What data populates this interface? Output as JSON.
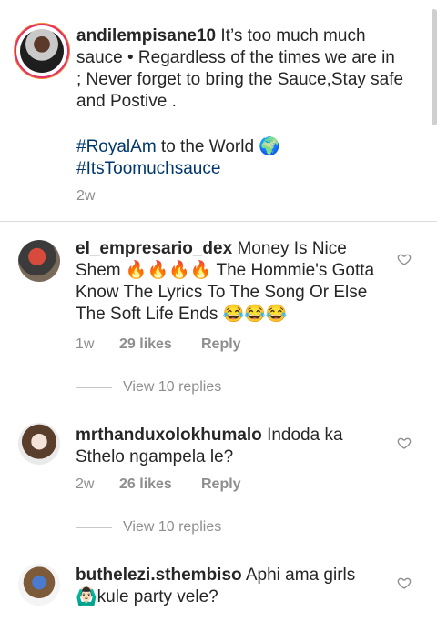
{
  "caption": {
    "username": "andilempisane10",
    "text": " It’s too much much sauce • Regardless of the times we are in ; Never forget to bring the Sauce,Stay safe and Postive .",
    "hashtag1": "#RoyalAm",
    "hashtag1_suffix": " to the World 🌍",
    "hashtag2": "#ItsToomuchsauce",
    "time": "2w"
  },
  "comments": [
    {
      "username": "el_empresario_dex",
      "text": " Money Is Nice Shem 🔥🔥🔥🔥 The Hommie's Gotta Know The Lyrics To The Song Or Else The Soft Life Ends 😂😂😂",
      "time": "1w",
      "likes": "29 likes",
      "reply": "Reply",
      "view_replies": "View 10 replies"
    },
    {
      "username": "mrthanduxolokhumalo",
      "text": " Indoda ka Sthelo ngampela le?",
      "time": "2w",
      "likes": "26 likes",
      "reply": "Reply",
      "view_replies": "View 10 replies"
    },
    {
      "username": "buthelezi.sthembiso",
      "text": " Aphi ama girls 🙆🏻‍♂️kule party vele?"
    }
  ],
  "colors": {
    "username": "#262626",
    "hashtag": "#00376b",
    "meta": "#8e8e8e",
    "divider": "#dbdbdb"
  },
  "icons": [
    "heart-outline-icon"
  ]
}
